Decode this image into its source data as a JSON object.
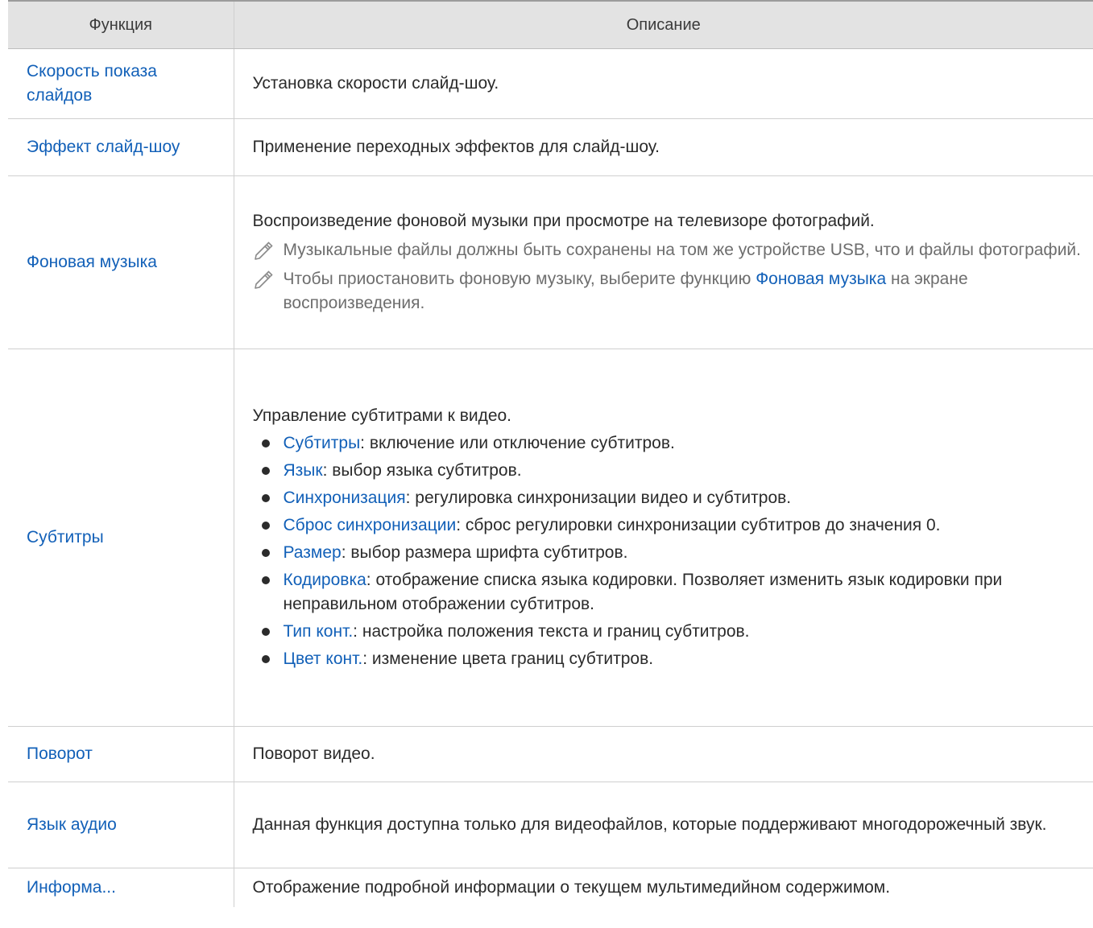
{
  "header": {
    "col_function": "Функция",
    "col_description": "Описание"
  },
  "rows": {
    "speed": {
      "function": "Скорость показа слайдов",
      "description": "Установка скорости слайд-шоу."
    },
    "effect": {
      "function": "Эффект слайд-шоу",
      "description": "Применение переходных эффектов для слайд-шоу."
    },
    "music": {
      "function": "Фоновая музыка",
      "description": "Воспроизведение фоновой музыки при просмотре на телевизоре фотографий.",
      "note1": "Музыкальные файлы должны быть сохранены на том же устройстве USB, что и файлы фотографий.",
      "note2_before": "Чтобы приостановить фоновую музыку, выберите функцию ",
      "note2_link": "Фоновая музыка",
      "note2_after": " на экране воспроизведения.",
      "note_icon": "pencil-icon"
    },
    "subtitles": {
      "function": "Субтитры",
      "intro": "Управление субтитрами к видео.",
      "items": [
        {
          "term": "Субтитры",
          "text": ": включение или отключение субтитров."
        },
        {
          "term": "Язык",
          "text": ": выбор языка субтитров."
        },
        {
          "term": "Синхронизация",
          "text": ": регулировка синхронизации видео и субтитров."
        },
        {
          "term": "Сброс синхронизации",
          "text": ": сброс регулировки синхронизации субтитров до значения 0."
        },
        {
          "term": "Размер",
          "text": ": выбор размера шрифта субтитров."
        },
        {
          "term": "Кодировка",
          "text": ": отображение списка языка кодировки. Позволяет изменить язык кодировки при неправильном отображении субтитров."
        },
        {
          "term": "Тип конт.",
          "text": ": настройка положения текста и границ субтитров."
        },
        {
          "term": "Цвет конт.",
          "text": ": изменение цвета границ субтитров."
        }
      ]
    },
    "rotate": {
      "function": "Поворот",
      "description": "Поворот видео."
    },
    "audio": {
      "function": "Язык аудио",
      "description": "Данная функция доступна только для видеофайлов, которые поддерживают многодорожечный звук."
    },
    "info": {
      "function": "Информа...",
      "description": "Отображение подробной информации о текущем мультимедийном содержимом."
    }
  },
  "colors": {
    "link": "#1260b8",
    "header_bg": "#e3e3e3",
    "note_text": "#6e6e6e"
  }
}
